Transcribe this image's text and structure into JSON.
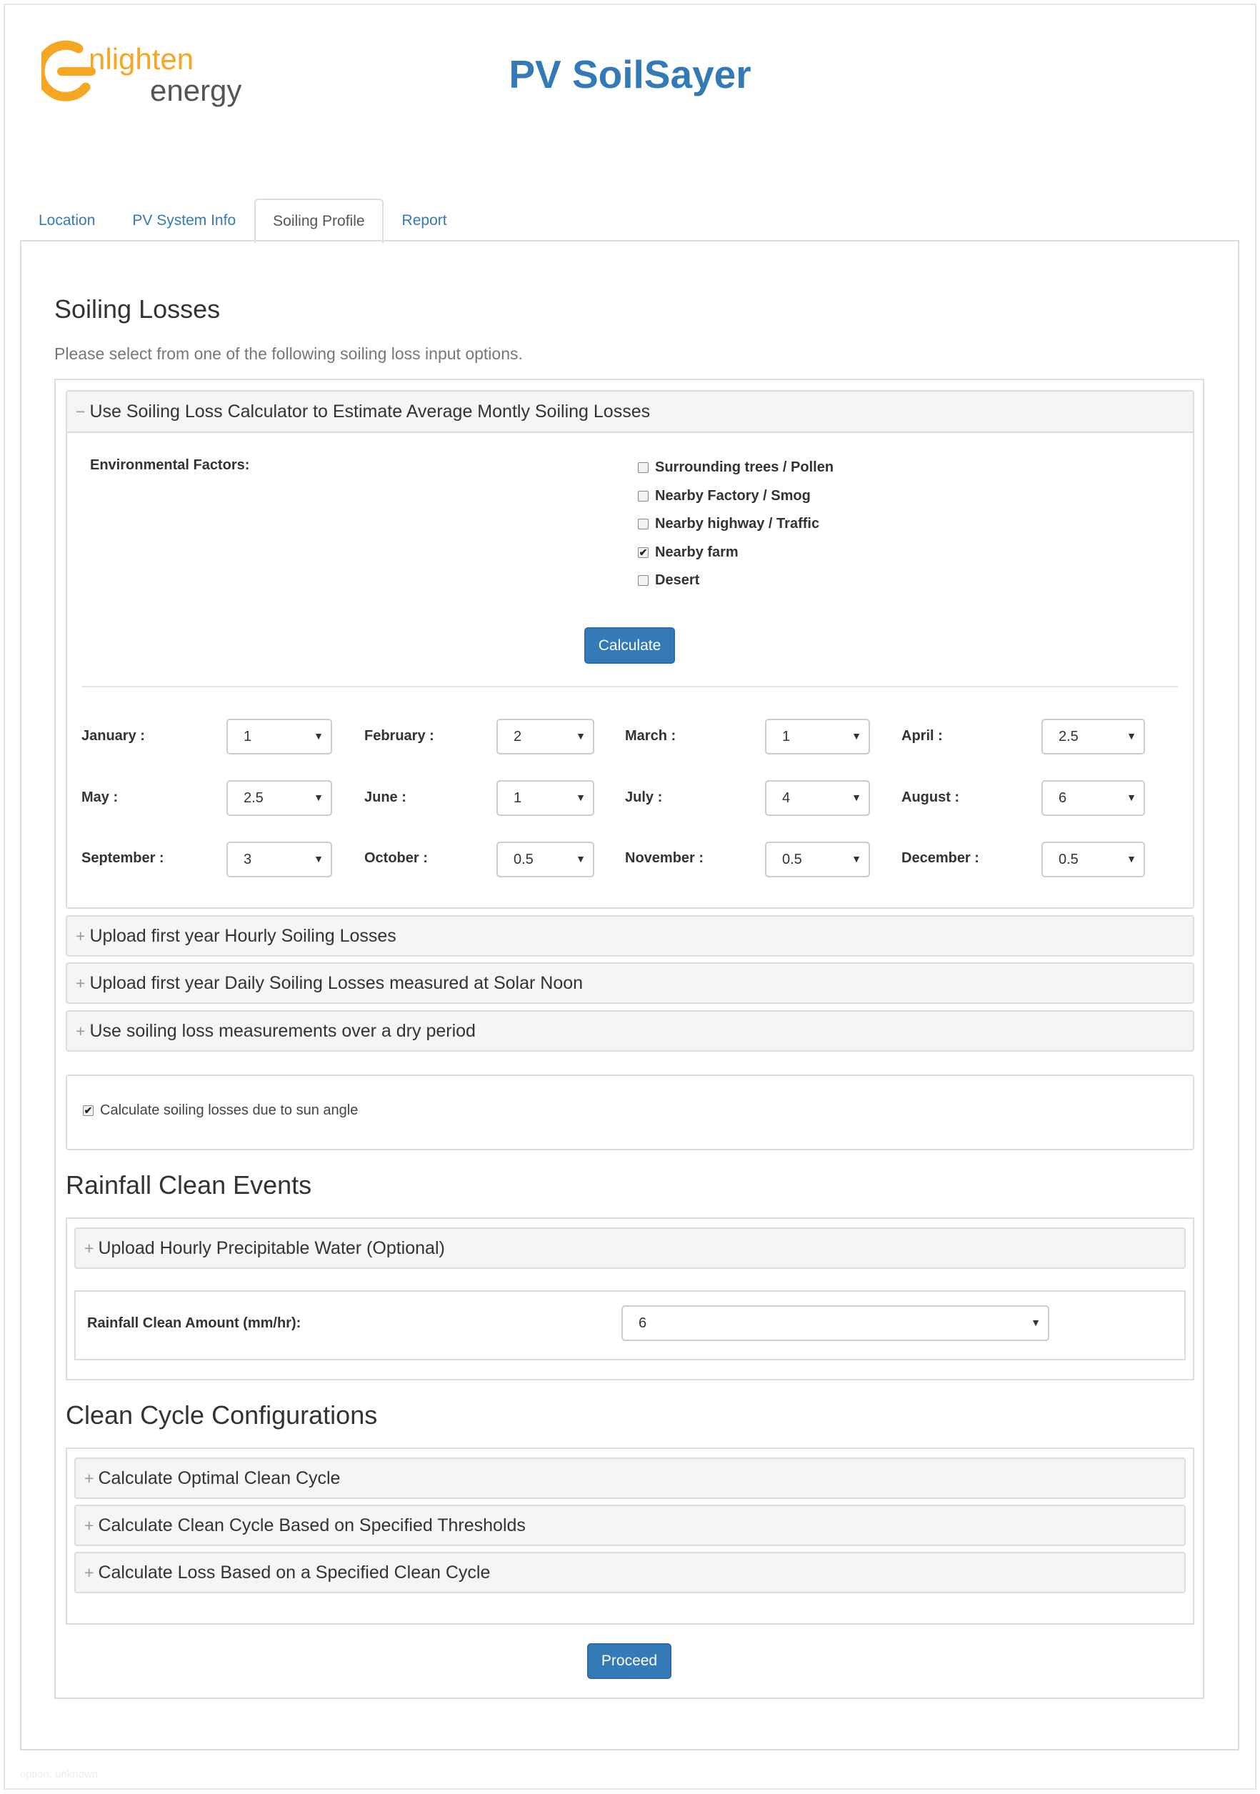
{
  "header": {
    "logo_top": "nlighten",
    "logo_bottom": "energy",
    "app_title": "PV SoilSayer"
  },
  "colors": {
    "accent": "#337ab7",
    "logo_orange": "#f5a623",
    "logo_text": "#555555"
  },
  "tabs": [
    {
      "label": "Location",
      "active": false
    },
    {
      "label": "PV System Info",
      "active": false
    },
    {
      "label": "Soiling Profile",
      "active": true
    },
    {
      "label": "Report",
      "active": false
    }
  ],
  "soiling": {
    "title": "Soiling Losses",
    "subtitle": "Please select from one of the following soiling loss input options.",
    "accordion1": {
      "sign": "−",
      "label": "Use Soiling Loss Calculator to Estimate Average Montly Soiling Losses",
      "env_label": "Environmental Factors:",
      "factors": [
        {
          "label": "Surrounding trees / Pollen",
          "checked": false
        },
        {
          "label": "Nearby Factory / Smog",
          "checked": false
        },
        {
          "label": "Nearby highway / Traffic",
          "checked": false
        },
        {
          "label": "Nearby farm",
          "checked": true
        },
        {
          "label": "Desert",
          "checked": false
        }
      ],
      "calculate_label": "Calculate",
      "months": [
        {
          "label": "January :",
          "value": "1"
        },
        {
          "label": "February :",
          "value": "2"
        },
        {
          "label": "March :",
          "value": "1"
        },
        {
          "label": "April :",
          "value": "2.5"
        },
        {
          "label": "May :",
          "value": "2.5"
        },
        {
          "label": "June :",
          "value": "1"
        },
        {
          "label": "July :",
          "value": "4"
        },
        {
          "label": "August :",
          "value": "6"
        },
        {
          "label": "September :",
          "value": "3"
        },
        {
          "label": "October :",
          "value": "0.5"
        },
        {
          "label": "November :",
          "value": "0.5"
        },
        {
          "label": "December :",
          "value": "0.5"
        }
      ]
    },
    "other_options": [
      {
        "sign": "+",
        "label": "Upload first year Hourly Soiling Losses"
      },
      {
        "sign": "+",
        "label": "Upload first year Daily Soiling Losses measured at Solar Noon"
      },
      {
        "sign": "+",
        "label": "Use soiling loss measurements over a dry period"
      }
    ],
    "sun_angle": {
      "label": "Calculate soiling losses due to sun angle",
      "checked": true
    }
  },
  "rainfall": {
    "title": "Rainfall Clean Events",
    "upload": {
      "sign": "+",
      "label": "Upload Hourly Precipitable Water (Optional)"
    },
    "amount_label": "Rainfall Clean Amount (mm/hr):",
    "amount_value": "6"
  },
  "clean_cycle": {
    "title": "Clean Cycle Configurations",
    "options": [
      {
        "sign": "+",
        "label": "Calculate Optimal Clean Cycle"
      },
      {
        "sign": "+",
        "label": "Calculate Clean Cycle Based on Specified Thresholds"
      },
      {
        "sign": "+",
        "label": "Calculate Loss Based on a Specified Clean Cycle"
      }
    ]
  },
  "proceed_label": "Proceed",
  "footer": "option: unknown",
  "icons": {
    "checkbox_checked": "✔",
    "dropdown": "▼"
  }
}
